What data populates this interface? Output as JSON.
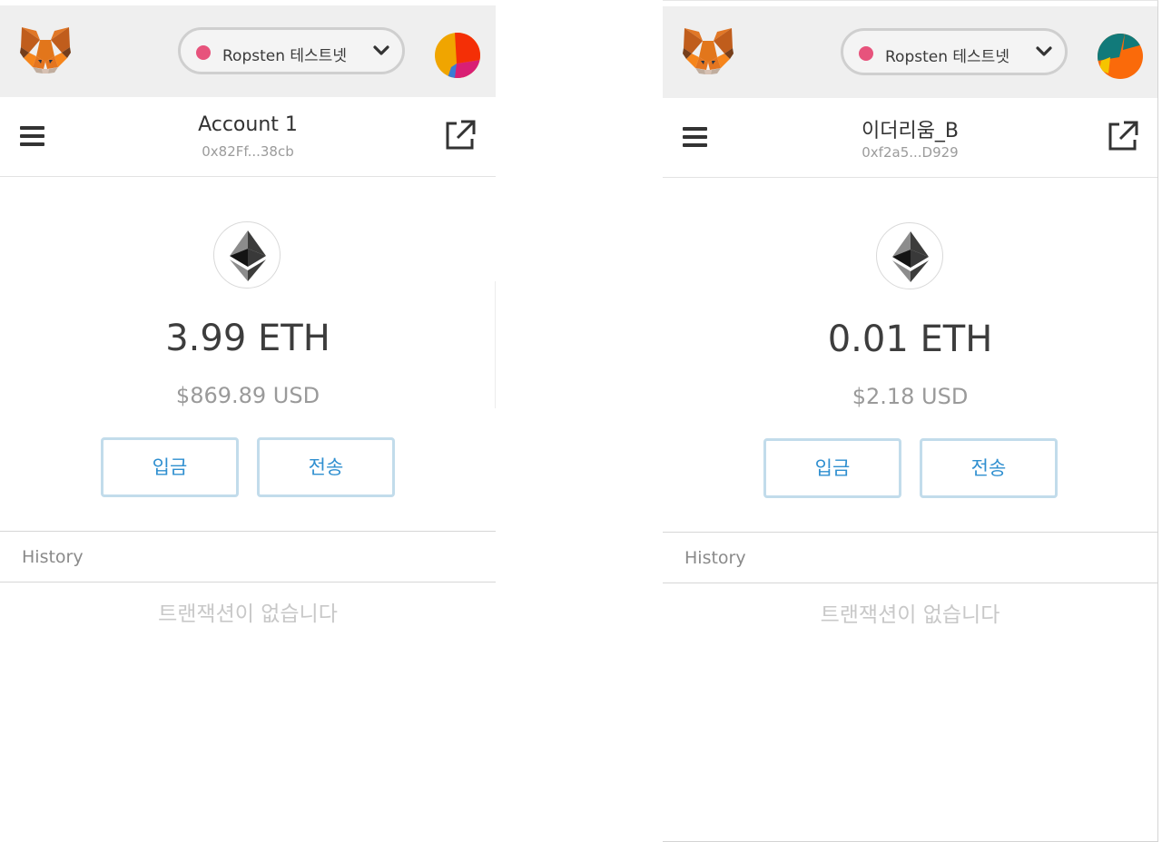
{
  "left": {
    "network_label": "Ropsten 테스트넷",
    "account_name": "Account 1",
    "account_address": "0x82Ff...38cb",
    "balance_eth": "3.99 ETH",
    "balance_fiat": "$869.89 USD",
    "deposit_label": "입금",
    "send_label": "전송",
    "history_label": "History",
    "empty_history": "트랜잭션이 없습니다",
    "avatar_colors": [
      "#f0a500",
      "#f42f06",
      "#d91f74",
      "#3a7bd5"
    ]
  },
  "right": {
    "network_label": "Ropsten 테스트넷",
    "account_name": "이더리움_B",
    "account_address": "0xf2a5...D929",
    "balance_eth": "0.01 ETH",
    "balance_fiat": "$2.18 USD",
    "deposit_label": "입금",
    "send_label": "전송",
    "history_label": "History",
    "empty_history": "트랜잭션이 없습니다",
    "avatar_colors": [
      "#fa6a0a",
      "#117a7a",
      "#f5c400"
    ]
  },
  "colors": {
    "network_dot": "#e7537c",
    "button_border": "#c2dceb",
    "button_text": "#2f8fd0",
    "header_bg": "#efefef"
  },
  "icons": [
    "metamask-fox-icon",
    "chevron-down-icon",
    "hamburger-menu-icon",
    "external-link-icon",
    "ethereum-icon"
  ]
}
